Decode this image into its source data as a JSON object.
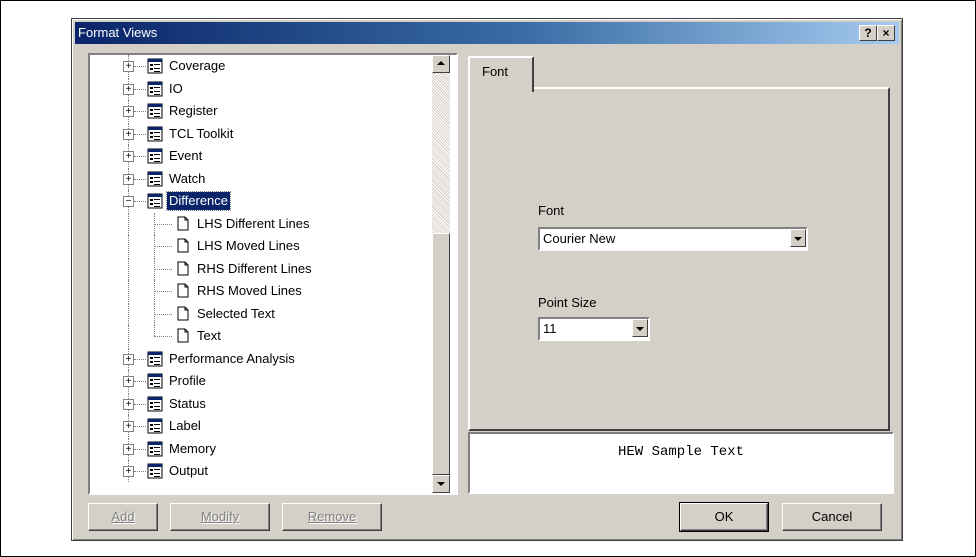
{
  "window": {
    "title": "Format Views",
    "help_glyph": "?",
    "close_glyph": "×"
  },
  "tree": {
    "items": [
      {
        "label": "Coverage",
        "type": "folder",
        "expander": "+"
      },
      {
        "label": "IO",
        "type": "folder",
        "expander": "+"
      },
      {
        "label": "Register",
        "type": "folder",
        "expander": "+"
      },
      {
        "label": "TCL Toolkit",
        "type": "folder",
        "expander": "+"
      },
      {
        "label": "Event",
        "type": "folder",
        "expander": "+"
      },
      {
        "label": "Watch",
        "type": "folder",
        "expander": "+"
      },
      {
        "label": "Difference",
        "type": "folder",
        "expander": "−",
        "selected": true
      },
      {
        "label": "LHS Different Lines",
        "type": "doc"
      },
      {
        "label": "LHS Moved Lines",
        "type": "doc"
      },
      {
        "label": "RHS Different Lines",
        "type": "doc"
      },
      {
        "label": "RHS Moved Lines",
        "type": "doc"
      },
      {
        "label": "Selected Text",
        "type": "doc"
      },
      {
        "label": "Text",
        "type": "doc"
      },
      {
        "label": "Performance Analysis",
        "type": "folder",
        "expander": "+"
      },
      {
        "label": "Profile",
        "type": "folder",
        "expander": "+"
      },
      {
        "label": "Status",
        "type": "folder",
        "expander": "+"
      },
      {
        "label": "Label",
        "type": "folder",
        "expander": "+"
      },
      {
        "label": "Memory",
        "type": "folder",
        "expander": "+"
      },
      {
        "label": "Output",
        "type": "folder",
        "expander": "+"
      }
    ]
  },
  "tabs": {
    "font_tab": "Font"
  },
  "font_panel": {
    "font_label": "Font",
    "font_value": "Courier New",
    "point_size_label": "Point Size",
    "point_size_value": "11"
  },
  "sample": {
    "text": "HEW Sample Text"
  },
  "buttons": {
    "add": "Add",
    "modify": "Modify",
    "remove": "Remove",
    "ok": "OK",
    "cancel": "Cancel"
  },
  "colors": {
    "selection": "#0a246a",
    "dialog_face": "#d4d0c8",
    "title_gradient_start": "#0a246a"
  }
}
